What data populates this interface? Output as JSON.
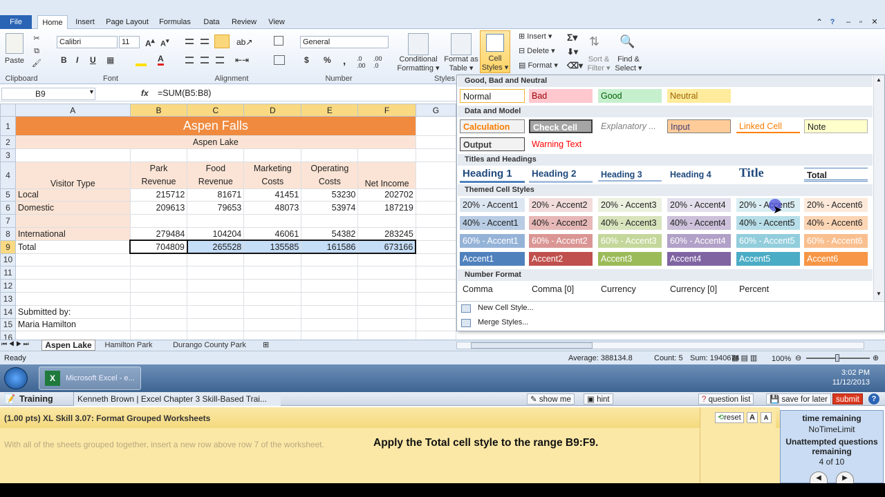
{
  "ribbon": {
    "tabs": [
      "File",
      "Home",
      "Insert",
      "Page Layout",
      "Formulas",
      "Data",
      "Review",
      "View"
    ],
    "font_name": "Calibri",
    "font_size": "11",
    "number_format": "General",
    "groups": {
      "clipboard": "Clipboard",
      "font": "Font",
      "alignment": "Alignment",
      "number": "Number",
      "styles": "Styles"
    },
    "paste": "Paste",
    "conditional_formatting": [
      "Conditional",
      "Formatting ▾"
    ],
    "format_as_table": [
      "Format as",
      "Table ▾"
    ],
    "cell_styles": [
      "Cell",
      "Styles ▾"
    ],
    "insert": "Insert ▾",
    "delete": "Delete ▾",
    "format": "Format ▾",
    "sort_filter": [
      "Sort &",
      "Filter ▾"
    ],
    "find_select": [
      "Find &",
      "Select ▾"
    ],
    "bold": "B",
    "italic": "I",
    "underline": "U",
    "fx": "fx"
  },
  "formula_bar": {
    "name_box": "B9",
    "formula": "=SUM(B5:B8)"
  },
  "columns": [
    "A",
    "B",
    "C",
    "D",
    "E",
    "F",
    "G"
  ],
  "rows": [
    {
      "n": "1",
      "a": "",
      "b": "",
      "c": "",
      "d": "",
      "e": "",
      "f": ""
    },
    {
      "n": "2"
    },
    {
      "n": "3"
    },
    {
      "n": "4"
    },
    {
      "n": "5"
    },
    {
      "n": "6"
    },
    {
      "n": "7"
    },
    {
      "n": "8"
    },
    {
      "n": "9"
    },
    {
      "n": "10"
    },
    {
      "n": "11"
    },
    {
      "n": "12"
    },
    {
      "n": "13"
    },
    {
      "n": "14"
    },
    {
      "n": "15"
    },
    {
      "n": "16"
    }
  ],
  "sheet": {
    "title": "Aspen Falls",
    "subtitle": "Aspen Lake",
    "headers_top": [
      "Park",
      "Food",
      "Marketing",
      "Operating"
    ],
    "headers_bottom": [
      "Visitor Type",
      "Revenue",
      "Revenue",
      "Costs",
      "Costs",
      "Net Income"
    ],
    "local": [
      "Local",
      "215712",
      "81671",
      "41451",
      "53230",
      "202702"
    ],
    "domestic": [
      "Domestic",
      "209613",
      "79653",
      "48073",
      "53974",
      "187219"
    ],
    "international": [
      "International",
      "279484",
      "104204",
      "46061",
      "54382",
      "283245"
    ],
    "total": [
      "Total",
      "704809",
      "265528",
      "135585",
      "161586",
      "673166"
    ],
    "submitted_by": "Submitted by:",
    "author": "Maria Hamilton"
  },
  "gallery": {
    "sections": [
      "Good, Bad and Neutral",
      "Data and Model",
      "Titles and Headings",
      "Themed Cell Styles",
      "Number Format"
    ],
    "good_bad": [
      "Normal",
      "Bad",
      "Good",
      "Neutral"
    ],
    "data_model_1": [
      "Calculation",
      "Check Cell",
      "Explanatory ...",
      "Input",
      "Linked Cell",
      "Note"
    ],
    "data_model_2": [
      "Output",
      "Warning Text"
    ],
    "titles": [
      "Heading 1",
      "Heading 2",
      "Heading 3",
      "Heading 4",
      "Title",
      "Total"
    ],
    "accent20": [
      "20% - Accent1",
      "20% - Accent2",
      "20% - Accent3",
      "20% - Accent4",
      "20% - Accent5",
      "20% - Accent6"
    ],
    "accent40": [
      "40% - Accent1",
      "40% - Accent2",
      "40% - Accent3",
      "40% - Accent4",
      "40% - Accent5",
      "40% - Accent6"
    ],
    "accent60": [
      "60% - Accent1",
      "60% - Accent2",
      "60% - Accent3",
      "60% - Accent4",
      "60% - Accent5",
      "60% - Accent6"
    ],
    "accent": [
      "Accent1",
      "Accent2",
      "Accent3",
      "Accent4",
      "Accent5",
      "Accent6"
    ],
    "number_format": [
      "Comma",
      "Comma [0]",
      "Currency",
      "Currency [0]",
      "Percent"
    ],
    "new_style": "New Cell Style...",
    "merge_styles": "Merge Styles..."
  },
  "sheet_tabs": [
    "Aspen Lake",
    "Hamilton Park",
    "Durango County Park"
  ],
  "status": {
    "ready": "Ready",
    "average": "Average: 388134.8",
    "count": "Count: 5",
    "sum": "Sum: 1940674",
    "zoom": "100%"
  },
  "taskbar": {
    "app": "Microsoft Excel - e...",
    "time": "3:02 PM",
    "date": "11/12/2013"
  },
  "training": {
    "label": "Training",
    "title": "Kenneth Brown | Excel Chapter 3 Skill-Based Trai...",
    "show_me": "show me",
    "hint": "hint",
    "question_list": "question list",
    "save_later": "save for later",
    "submit": "submit",
    "skill": "(1.00 pts) XL Skill 3.07: Format Grouped Worksheets",
    "reset": "reset",
    "instruction_faded": "With all of the sheets grouped together, insert a new row above row 7 of the worksheet.",
    "instruction": "Apply the Total cell style to the range B9:F9.",
    "time_label": "time remaining",
    "time_value": "NoTimeLimit",
    "unattempted": "Unattempted questions remaining",
    "progress": "4 of 10"
  }
}
